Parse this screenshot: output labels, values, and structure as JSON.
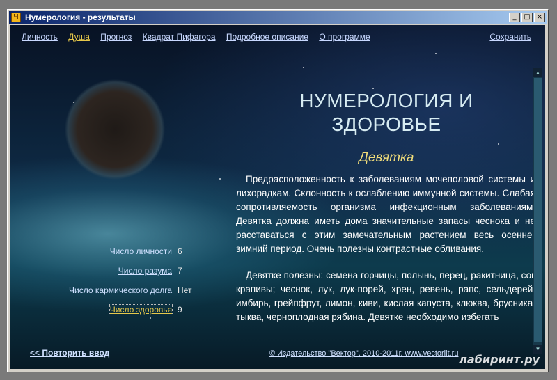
{
  "window": {
    "title": "Нумерология - результаты",
    "icon": "numerology-app-icon"
  },
  "nav": {
    "items": [
      {
        "label": "Личность"
      },
      {
        "label": "Душа"
      },
      {
        "label": "Прогноз"
      },
      {
        "label": "Квадрат Пифагора"
      },
      {
        "label": "Подробное описание"
      },
      {
        "label": "О программе"
      }
    ],
    "active": "Душа",
    "save_label": "Сохранить"
  },
  "article": {
    "title_line1": "НУМЕРОЛОГИЯ И",
    "title_line2": "ЗДОРОВЬЕ",
    "subtitle": "Девятка",
    "paragraphs": [
      "Предрасположенность к заболеваниям мочеполовой системы и лихорадкам. Склонность к ослаблению иммунной системы. Слабая сопротивляемость организма инфекционным заболеваниям. Девятка должна иметь дома значительные запасы чеснока и не расставаться с этим замечательным растением весь осенне-зимний период. Очень полезны контрастные обливания.",
      "Девятке полезны: семена горчицы, полынь, перец, ракитница, сок крапивы; чеснок, лук, лук-порей, хрен, ревень, рапс, сельдерей, имбирь, грейпфрут, лимон, киви, кислая капуста, клюква, брусника, тыква, черноплодная рябина. Девятке необходимо избегать"
    ]
  },
  "numbers": [
    {
      "label": "Число личности",
      "value": "6"
    },
    {
      "label": "Число разума",
      "value": "7"
    },
    {
      "label": "Число кармического долга",
      "value": "Нет"
    },
    {
      "label": "Число здоровья",
      "value": "9",
      "active": true
    }
  ],
  "footer": {
    "back_label": "<< Повторить ввод",
    "copyright": "© Издательство \"Вектор\", 2010-2011г. www.vectorlit.ru",
    "watermark": "лабиринт.ру"
  }
}
